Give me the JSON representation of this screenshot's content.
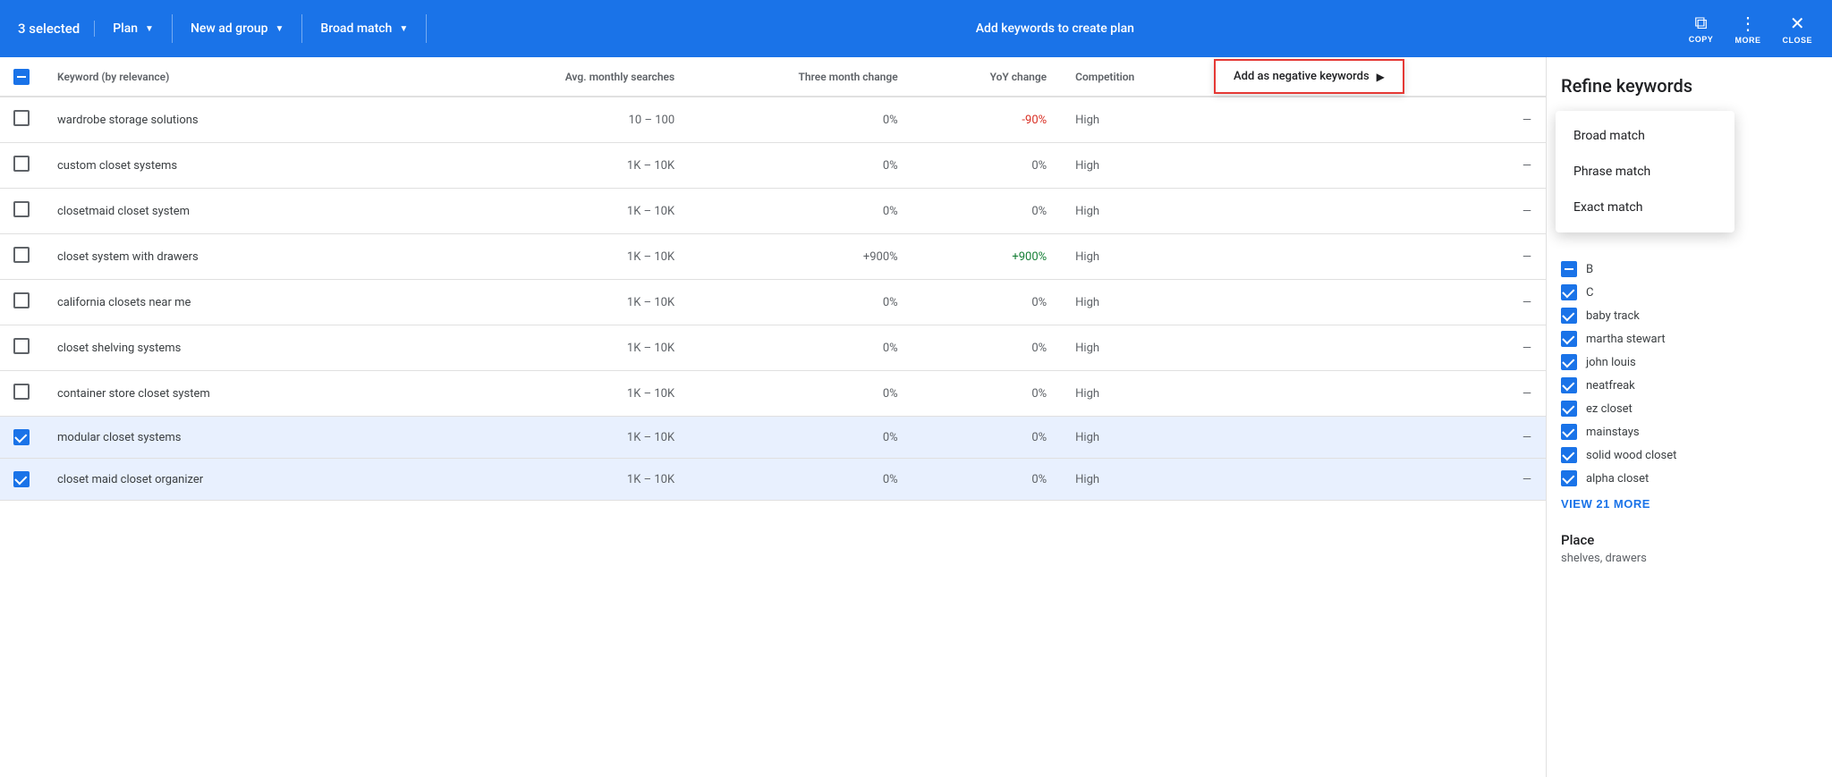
{
  "toolbar": {
    "selected_label": "3 selected",
    "plan_label": "Plan",
    "new_ad_group_label": "New ad group",
    "broad_match_label": "Broad match",
    "add_keywords_label": "Add keywords to create plan",
    "copy_label": "COPY",
    "more_label": "MORE",
    "close_label": "CLOSE"
  },
  "table": {
    "header": {
      "checkbox_col": "",
      "keyword_col": "Keyword (by relevance)",
      "searches_col": "Avg. monthly searches",
      "three_month_col": "Three month change",
      "yoy_col": "YoY change",
      "competition_col": "Competition",
      "last_col": ""
    },
    "neg_kw_button": "Add as negative keywords",
    "rows": [
      {
        "id": 1,
        "checked": false,
        "keyword": "wardrobe storage solutions",
        "searches": "10 – 100",
        "three_month": "0%",
        "yoy": "-90%",
        "competition": "High",
        "last": "—",
        "selected": false
      },
      {
        "id": 2,
        "checked": false,
        "keyword": "custom closet systems",
        "searches": "1K – 10K",
        "three_month": "0%",
        "yoy": "0%",
        "competition": "High",
        "last": "—",
        "selected": false
      },
      {
        "id": 3,
        "checked": false,
        "keyword": "closetmaid closet system",
        "searches": "1K – 10K",
        "three_month": "0%",
        "yoy": "0%",
        "competition": "High",
        "last": "—",
        "selected": false
      },
      {
        "id": 4,
        "checked": false,
        "keyword": "closet system with drawers",
        "searches": "1K – 10K",
        "three_month": "+900%",
        "yoy": "+900%",
        "competition": "High",
        "last": "—",
        "selected": false
      },
      {
        "id": 5,
        "checked": false,
        "keyword": "california closets near me",
        "searches": "1K – 10K",
        "three_month": "0%",
        "yoy": "0%",
        "competition": "High",
        "last": "—",
        "selected": false
      },
      {
        "id": 6,
        "checked": false,
        "keyword": "closet shelving systems",
        "searches": "1K – 10K",
        "three_month": "0%",
        "yoy": "0%",
        "competition": "High",
        "last": "—",
        "selected": false
      },
      {
        "id": 7,
        "checked": false,
        "keyword": "container store closet system",
        "searches": "1K – 10K",
        "three_month": "0%",
        "yoy": "0%",
        "competition": "High",
        "last": "—",
        "selected": false
      },
      {
        "id": 8,
        "checked": true,
        "keyword": "modular closet systems",
        "searches": "1K – 10K",
        "three_month": "0%",
        "yoy": "0%",
        "competition": "High",
        "last": "—",
        "selected": true
      },
      {
        "id": 9,
        "checked": true,
        "keyword": "closet maid closet organizer",
        "searches": "1K – 10K",
        "three_month": "0%",
        "yoy": "0%",
        "competition": "High",
        "last": "—",
        "selected": true
      }
    ]
  },
  "neg_menu": {
    "items": [
      "Broad match",
      "Phrase match",
      "Exact match"
    ]
  },
  "sidebar": {
    "title": "Refine keywords",
    "items": [
      {
        "label": "B",
        "checked": true,
        "indeterminate": true
      },
      {
        "label": "C",
        "checked": true,
        "indeterminate": false
      },
      {
        "label": "baby track",
        "checked": true,
        "indeterminate": false
      },
      {
        "label": "martha stewart",
        "checked": true,
        "indeterminate": false
      },
      {
        "label": "john louis",
        "checked": true,
        "indeterminate": false
      },
      {
        "label": "neatfreak",
        "checked": true,
        "indeterminate": false
      },
      {
        "label": "ez closet",
        "checked": true,
        "indeterminate": false
      },
      {
        "label": "mainstays",
        "checked": true,
        "indeterminate": false
      },
      {
        "label": "solid wood closet",
        "checked": true,
        "indeterminate": false
      },
      {
        "label": "alpha closet",
        "checked": true,
        "indeterminate": false
      }
    ],
    "view_more_label": "VIEW 21 MORE",
    "place_title": "Place",
    "place_text": "shelves, drawers"
  }
}
